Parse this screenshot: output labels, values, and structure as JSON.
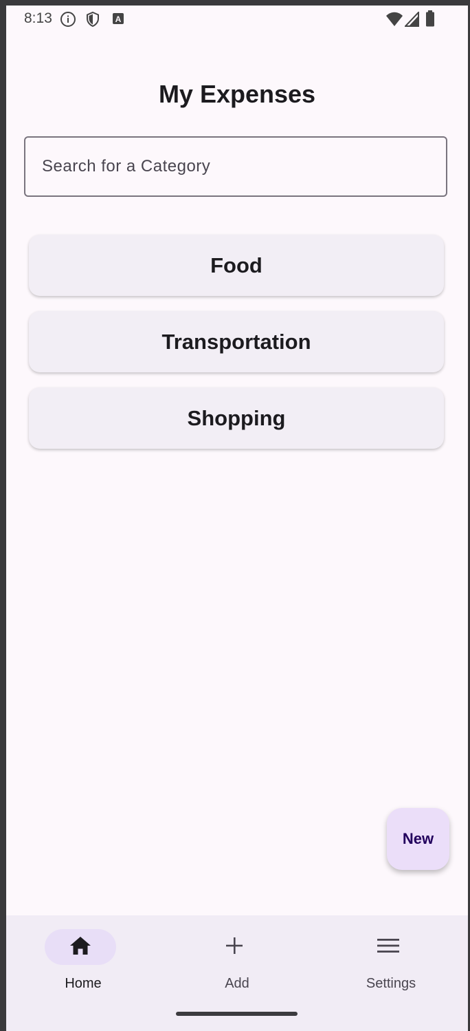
{
  "status_bar": {
    "time": "8:13",
    "left_icons": [
      "info-icon",
      "shield-icon",
      "a-icon"
    ],
    "right_icons": [
      "wifi-icon",
      "signal-icon",
      "battery-icon"
    ]
  },
  "header": {
    "title": "My Expenses"
  },
  "search": {
    "placeholder": "Search for a Category",
    "value": ""
  },
  "categories": [
    {
      "label": "Food"
    },
    {
      "label": "Transportation"
    },
    {
      "label": "Shopping"
    }
  ],
  "fab": {
    "label": "New"
  },
  "bottom_nav": {
    "items": [
      {
        "label": "Home",
        "icon": "home-icon",
        "active": true
      },
      {
        "label": "Add",
        "icon": "plus-icon",
        "active": false
      },
      {
        "label": "Settings",
        "icon": "menu-icon",
        "active": false
      }
    ]
  },
  "colors": {
    "background": "#fdf8fc",
    "card": "#f2eef5",
    "fab": "#ebdef9",
    "nav_bar": "#f1ecf5",
    "nav_active_pill": "#e8def7",
    "text": "#1c1b1f"
  }
}
